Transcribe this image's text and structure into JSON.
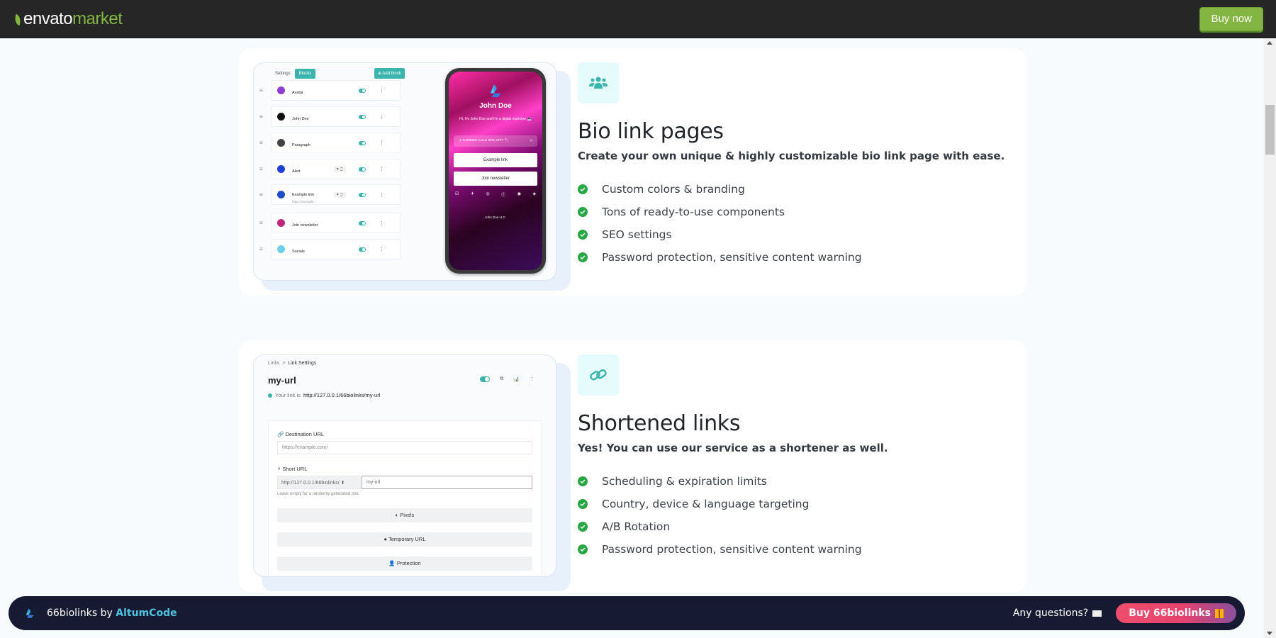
{
  "envato": {
    "logo_word1": "envato",
    "logo_word2": "market",
    "buy_now_label": "Buy now"
  },
  "features": [
    {
      "icon": "users-icon",
      "title": "Bio link pages",
      "subtitle": "Create your own unique & highly customizable bio link page with ease.",
      "bullets": [
        "Custom colors & branding",
        "Tons of ready-to-use components",
        "SEO settings",
        "Password protection, sensitive content warning"
      ],
      "preview": {
        "tabs": [
          "Settings",
          "Blocks"
        ],
        "active_tab": "Blocks",
        "add_block_label": "Add block",
        "blocks": [
          {
            "name": "Avatar",
            "color": "#8e3fd1"
          },
          {
            "name": "John Doe",
            "color": "#111111"
          },
          {
            "name": "Paragraph",
            "color": "#444444"
          },
          {
            "name": "Alert",
            "color": "#1f3fd6",
            "tag": "⚑ ⌚"
          },
          {
            "name": "Example link",
            "sub": "https://example...",
            "color": "#1e4fc9",
            "tag": "⚑ ⌚"
          },
          {
            "name": "Join newsletter",
            "color": "#c0267a"
          },
          {
            "name": "Socials",
            "color": "#6dd0ea"
          }
        ],
        "phone": {
          "name": "John Doe",
          "bio": "Hi, I'm John Doe and I'm a digital marketer 💻",
          "alert": "SUMMER SALE 50% OFF! 🏷",
          "buttons": [
            "Example link",
            "Join newsletter"
          ],
          "socials": [
            "☑",
            "✈",
            "◎",
            "ⓕ",
            "◉",
            "◈"
          ],
          "footer": "John Doe LLC."
        }
      }
    },
    {
      "icon": "link-icon",
      "title": "Shortened links",
      "subtitle": "Yes! You can use our service as a shortener as well.",
      "bullets": [
        "Scheduling & expiration limits",
        "Country, device & language targeting",
        "A/B Rotation",
        "Password protection, sensitive content warning"
      ],
      "preview": {
        "breadcrumb": [
          "Links",
          "Link Settings"
        ],
        "breadcrumb_sep": ">",
        "title": "my-url",
        "link_prefix": "Your link is",
        "link_url": "http://127.0.0.1/66biolinks/my-url",
        "destination_label": "Destination URL",
        "destination_placeholder": "https://example.com/",
        "short_url_label": "Short URL",
        "short_url_domain": "http://127.0.0.1/66biolinks/",
        "short_url_value": "my-url",
        "short_url_help": "Leave empty for a randomly generated one.",
        "sections": [
          "Pixels",
          "Temporary URL",
          "Protection"
        ]
      }
    }
  ],
  "bottom_bar": {
    "product": "66biolinks by",
    "brand": "AltumCode",
    "questions_label": "Any questions?",
    "buy_label": "Buy 66biolinks"
  }
}
